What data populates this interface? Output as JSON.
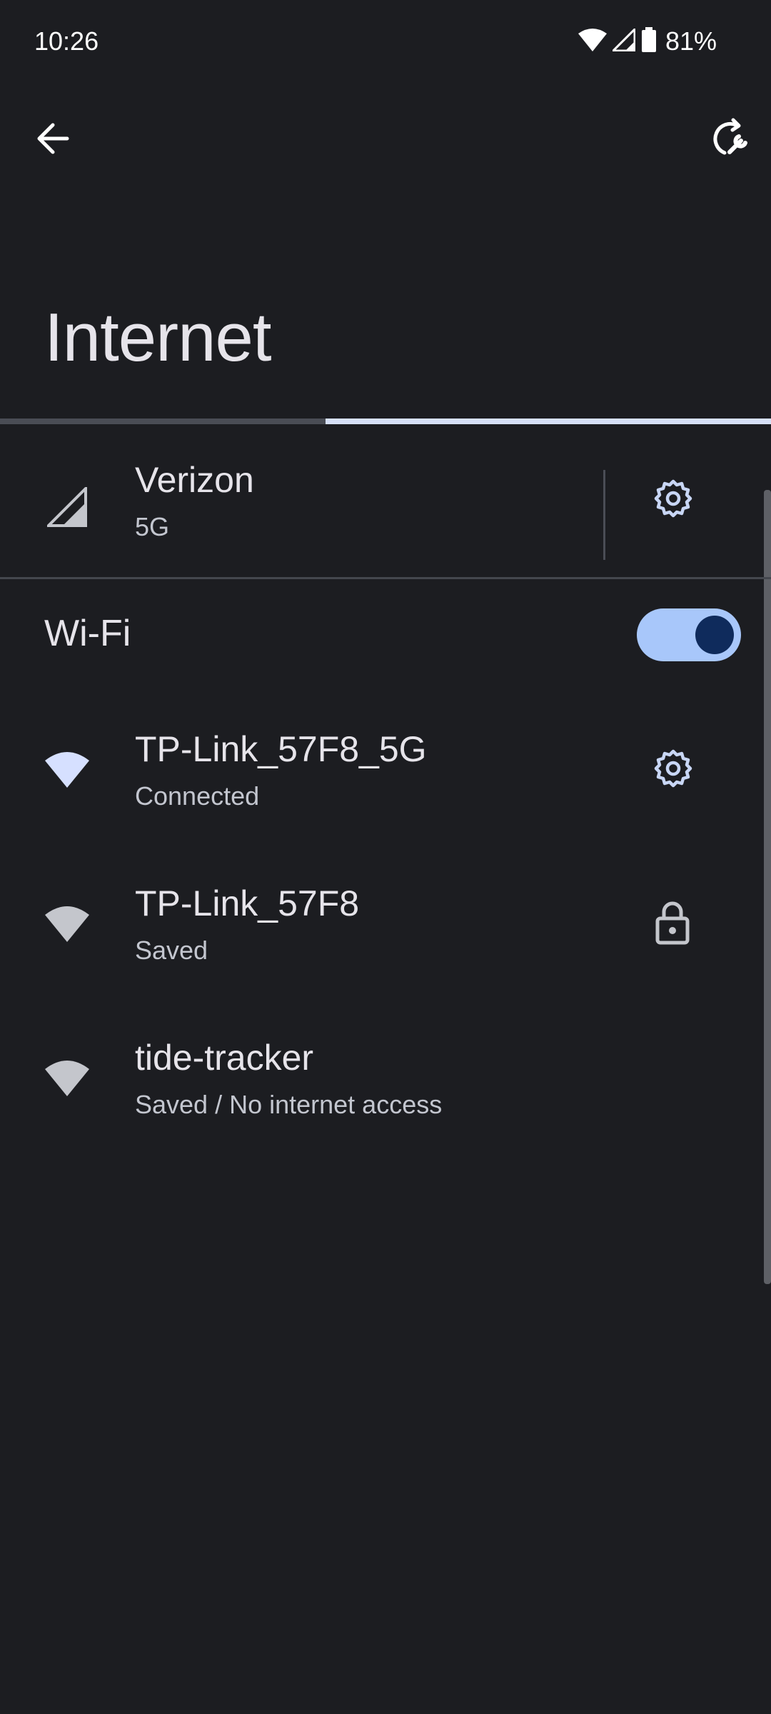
{
  "status_bar": {
    "time": "10:26",
    "battery": "81%",
    "icons": [
      "wifi-icon",
      "cellular-signal-icon",
      "battery-icon"
    ]
  },
  "app_bar": {
    "back_icon": "arrow-back-icon",
    "diagnostics_icon": "network-reset-icon"
  },
  "page": {
    "title": "Internet"
  },
  "progress": {
    "value_fraction": 0.58
  },
  "mobile": {
    "carrier": "Verizon",
    "network_type": "5G",
    "icon": "cellular-signal-icon",
    "settings_icon": "gear-icon"
  },
  "wifi": {
    "label": "Wi-Fi",
    "enabled": true,
    "networks": [
      {
        "name": "TP-Link_57F8_5G",
        "status": "Connected",
        "trailing_icon": "gear-icon"
      },
      {
        "name": "TP-Link_57F8",
        "status": "Saved",
        "trailing_icon": "lock-icon"
      },
      {
        "name": "tide-tracker",
        "status": "Saved / No internet access",
        "trailing_icon": ""
      }
    ]
  },
  "colors": {
    "background": "#1c1d21",
    "accent": "#a8c7fa",
    "accent_dark": "#0f2b5c",
    "connected_wifi": "#d6e0ff",
    "saved_wifi": "#c4c6cc"
  }
}
